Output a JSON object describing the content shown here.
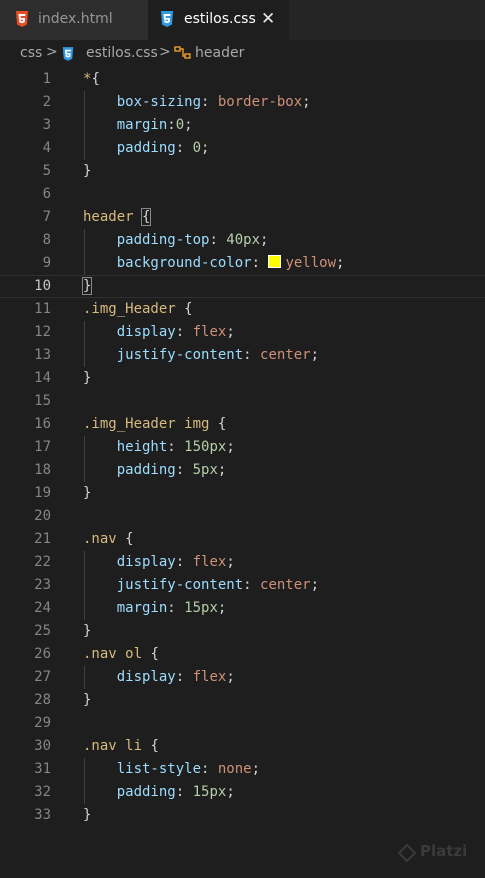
{
  "tabs": [
    {
      "label": "index.html",
      "icon": "html5-icon",
      "active": false
    },
    {
      "label": "estilos.css",
      "icon": "css3-icon",
      "active": true,
      "close": "✕"
    }
  ],
  "breadcrumb": {
    "folder": "css",
    "file": "estilos.css",
    "symbol": "header",
    "separator": ">"
  },
  "colors": {
    "html_icon": "#e44d26",
    "css_icon": "#2f9ae0",
    "selector": "#d7ba7d",
    "property": "#9cdcfe",
    "value": "#ce9178",
    "number": "#b5cea8",
    "swatch": "#ffff00"
  },
  "watermark": "Platzi",
  "code": [
    {
      "n": "1",
      "t": "*{"
    },
    {
      "n": "2",
      "t": "    box-sizing: border-box;"
    },
    {
      "n": "3",
      "t": "    margin:0;"
    },
    {
      "n": "4",
      "t": "    padding: 0;"
    },
    {
      "n": "5",
      "t": "}"
    },
    {
      "n": "6",
      "t": ""
    },
    {
      "n": "7",
      "t": "header {"
    },
    {
      "n": "8",
      "t": "    padding-top: 40px;"
    },
    {
      "n": "9",
      "t": "    background-color: yellow;"
    },
    {
      "n": "10",
      "t": "}"
    },
    {
      "n": "11",
      "t": ".img_Header {"
    },
    {
      "n": "12",
      "t": "    display: flex;"
    },
    {
      "n": "13",
      "t": "    justify-content: center;"
    },
    {
      "n": "14",
      "t": "}"
    },
    {
      "n": "15",
      "t": ""
    },
    {
      "n": "16",
      "t": ".img_Header img {"
    },
    {
      "n": "17",
      "t": "    height: 150px;"
    },
    {
      "n": "18",
      "t": "    padding: 5px;"
    },
    {
      "n": "19",
      "t": "}"
    },
    {
      "n": "20",
      "t": ""
    },
    {
      "n": "21",
      "t": ".nav {"
    },
    {
      "n": "22",
      "t": "    display: flex;"
    },
    {
      "n": "23",
      "t": "    justify-content: center;"
    },
    {
      "n": "24",
      "t": "    margin: 15px;"
    },
    {
      "n": "25",
      "t": "}"
    },
    {
      "n": "26",
      "t": ".nav ol {"
    },
    {
      "n": "27",
      "t": "    display: flex;"
    },
    {
      "n": "28",
      "t": "}"
    },
    {
      "n": "29",
      "t": ""
    },
    {
      "n": "30",
      "t": ".nav li {"
    },
    {
      "n": "31",
      "t": "    list-style: none;"
    },
    {
      "n": "32",
      "t": "    padding: 15px;"
    },
    {
      "n": "33",
      "t": "}"
    }
  ]
}
